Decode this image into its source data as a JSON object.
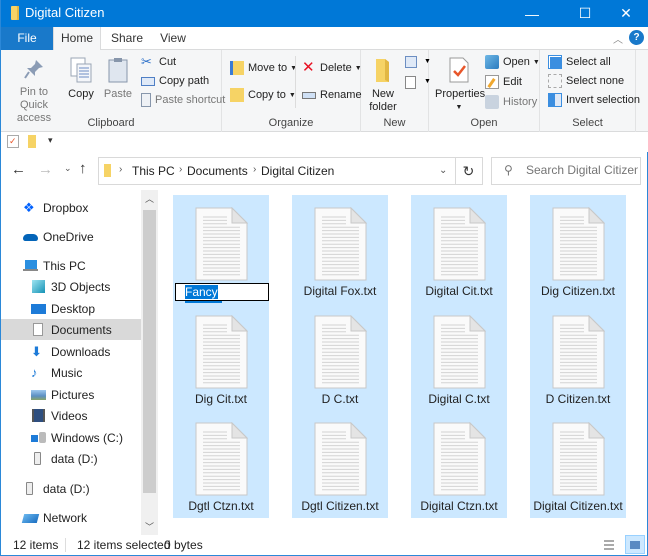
{
  "window": {
    "title": "Digital Citizen",
    "controls": {
      "minimize": "—",
      "maximize": "☐",
      "close": "✕"
    }
  },
  "ribbon_tabs": [
    {
      "label": "File"
    },
    {
      "label": "Home"
    },
    {
      "label": "Share"
    },
    {
      "label": "View"
    }
  ],
  "ribbon": {
    "clipboard": {
      "label": "Clipboard",
      "pin": "Pin to Quick access",
      "copy": "Copy",
      "paste": "Paste",
      "cut": "Cut",
      "copy_path": "Copy path",
      "paste_shortcut": "Paste shortcut"
    },
    "organize": {
      "label": "Organize",
      "move_to": "Move to",
      "copy_to": "Copy to",
      "delete": "Delete",
      "rename": "Rename"
    },
    "new": {
      "label": "New",
      "new_folder": "New folder"
    },
    "open": {
      "label": "Open",
      "properties": "Properties",
      "open": "Open",
      "edit": "Edit",
      "history": "History"
    },
    "select": {
      "label": "Select",
      "select_all": "Select all",
      "select_none": "Select none",
      "invert": "Invert selection"
    }
  },
  "address": {
    "crumbs": [
      "This PC",
      "Documents",
      "Digital Citizen"
    ],
    "search_placeholder": "Search Digital Citizen"
  },
  "sidebar": {
    "items": [
      {
        "label": "Dropbox",
        "icon": "dropbox-icon"
      },
      {
        "label": "OneDrive",
        "icon": "onedrive-icon"
      },
      {
        "label": "This PC",
        "icon": "this-pc-icon"
      },
      {
        "label": "3D Objects",
        "icon": "3d-objects-icon"
      },
      {
        "label": "Desktop",
        "icon": "desktop-icon"
      },
      {
        "label": "Documents",
        "icon": "documents-icon",
        "selected": true
      },
      {
        "label": "Downloads",
        "icon": "downloads-icon"
      },
      {
        "label": "Music",
        "icon": "music-icon"
      },
      {
        "label": "Pictures",
        "icon": "pictures-icon"
      },
      {
        "label": "Videos",
        "icon": "videos-icon"
      },
      {
        "label": "Windows (C:)",
        "icon": "drive-c-icon"
      },
      {
        "label": "data (D:)",
        "icon": "drive-d-icon"
      },
      {
        "label": "data (D:)",
        "icon": "drive-d-icon"
      },
      {
        "label": "Network",
        "icon": "network-icon"
      }
    ]
  },
  "files": {
    "rename_field": {
      "selected_part": "Fancy Citizen",
      "extension": ".txt"
    },
    "items": [
      {
        "name": "Fancy Citizen.txt"
      },
      {
        "name": "Digital Fox.txt"
      },
      {
        "name": "Digital Cit.txt"
      },
      {
        "name": "Dig Citizen.txt"
      },
      {
        "name": "Dig Cit.txt"
      },
      {
        "name": "D C.txt"
      },
      {
        "name": "Digital C.txt"
      },
      {
        "name": "D Citizen.txt"
      },
      {
        "name": "Dgtl Ctzn.txt"
      },
      {
        "name": "Dgtl Citizen.txt"
      },
      {
        "name": "Digital Ctzn.txt"
      },
      {
        "name": "Digital Citizen.txt"
      }
    ]
  },
  "status": {
    "item_count": "12 items",
    "selection": "12 items selected",
    "size": "0 bytes"
  },
  "colors": {
    "titlebar": "#0078d7",
    "selection": "#cce8ff",
    "file_tab": "#1979ca"
  }
}
